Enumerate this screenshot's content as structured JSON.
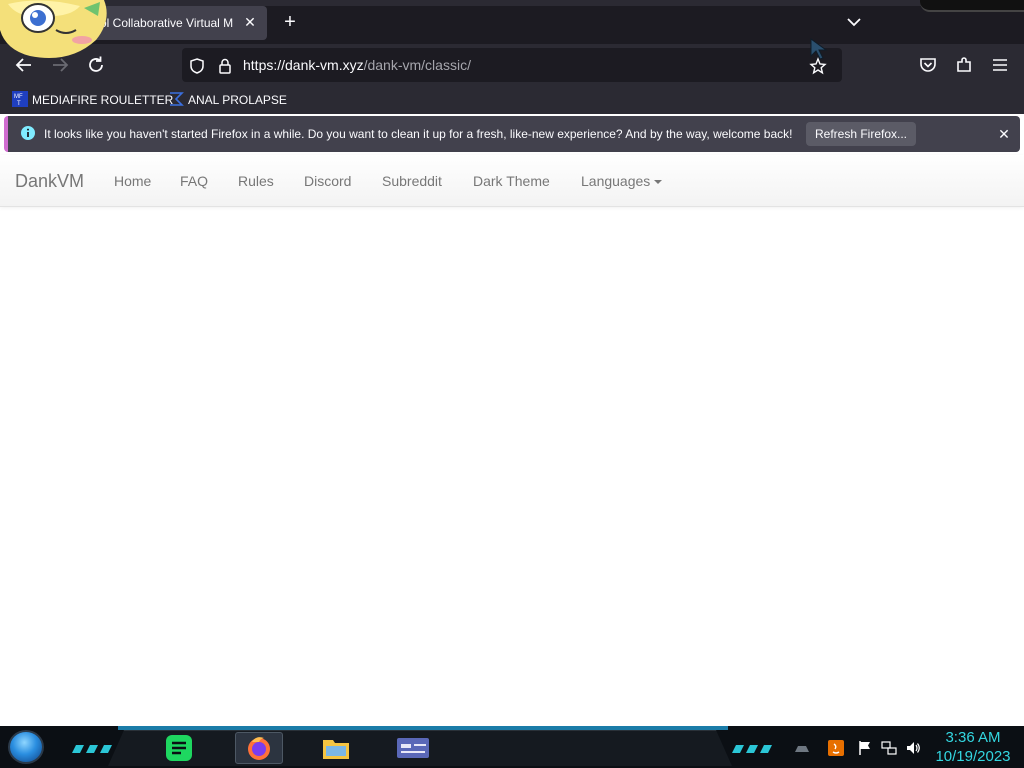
{
  "browser": {
    "tab": {
      "title": "ol Collaborative Virtual M",
      "close_label": "✕"
    },
    "new_tab_label": "+",
    "url": {
      "host": "https://dank-vm.xyz",
      "path": "/dank-vm/classic/"
    },
    "bookmarks": [
      {
        "label": "MEDIAFIRE ROULETTER",
        "icon": "mediafire-icon"
      },
      {
        "label": "ANAL PROLAPSE",
        "icon": "sigma-icon"
      }
    ],
    "notification": {
      "text": "It looks like you haven't started Firefox in a while. Do you want to clean it up for a fresh, like-new experience? And by the way, welcome back!",
      "button_label": "Refresh Firefox...",
      "close_label": "✕"
    }
  },
  "site": {
    "brand": "DankVM",
    "nav": [
      {
        "label": "Home"
      },
      {
        "label": "FAQ"
      },
      {
        "label": "Rules"
      },
      {
        "label": "Discord"
      },
      {
        "label": "Subreddit"
      },
      {
        "label": "Dark Theme"
      },
      {
        "label": "Languages"
      }
    ]
  },
  "taskbar": {
    "apps": [
      "notes-app-icon",
      "firefox-icon",
      "file-explorer-icon",
      "window-app-icon"
    ],
    "tray": [
      "java-icon",
      "flag-icon",
      "network-icon",
      "volume-icon"
    ],
    "clock": {
      "time": "3:36 AM",
      "date": "10/19/2023"
    }
  },
  "colors": {
    "chrome_dark": "#1c1b22",
    "chrome_mid": "#2b2a33",
    "notification_bg": "#42414d",
    "clock": "#33d6e0",
    "nav_text": "#777777"
  }
}
